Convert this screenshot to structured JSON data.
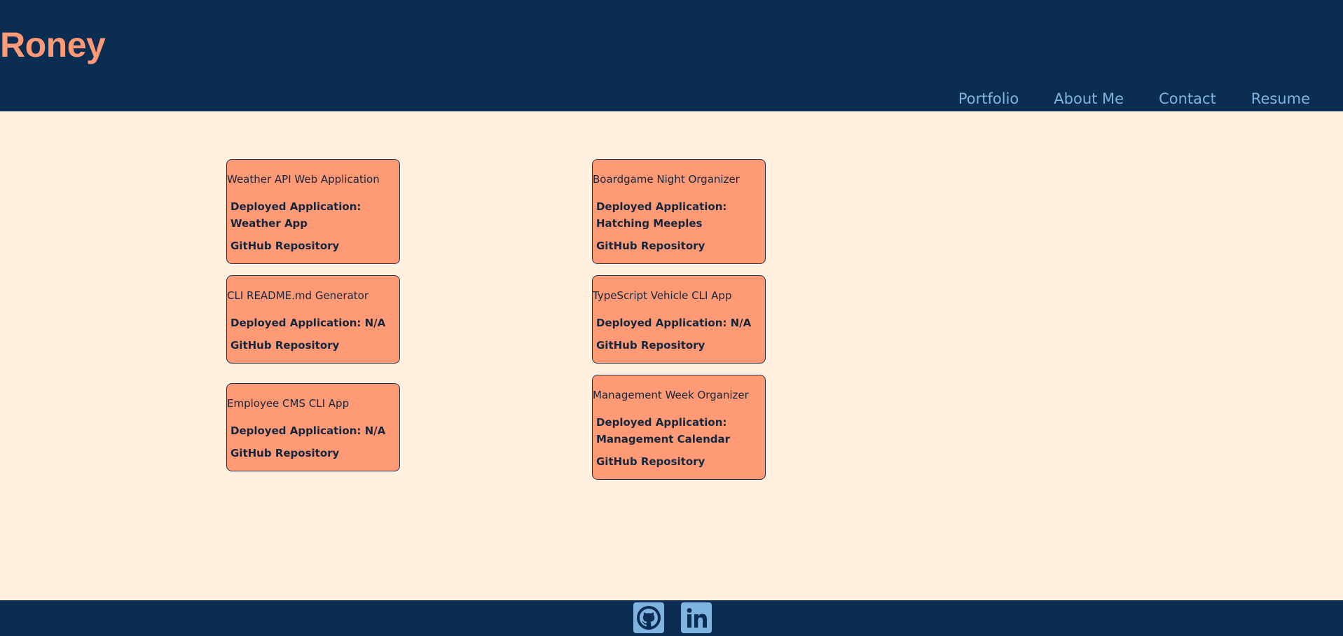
{
  "header": {
    "brand": "Roney",
    "nav": [
      "Portfolio",
      "About Me",
      "Contact",
      "Resume"
    ]
  },
  "projects": [
    {
      "title": "Weather API Web Application",
      "deployed": "Deployed Application: Weather App",
      "repo": "GitHub Repository"
    },
    {
      "title": "Boardgame Night Organizer",
      "deployed": "Deployed Application: Hatching Meeples",
      "repo": "GitHub Repository"
    },
    {
      "title": "CLI README.md Generator",
      "deployed": "Deployed Application: N/A",
      "repo": "GitHub Repository"
    },
    {
      "title": "TypeScript Vehicle CLI App",
      "deployed": "Deployed Application: N/A",
      "repo": "GitHub Repository"
    },
    {
      "title": "Employee CMS CLI App",
      "deployed": "Deployed Application: N/A",
      "repo": "GitHub Repository"
    },
    {
      "title": "Management Week Organizer",
      "deployed": "Deployed Application: Management Calendar",
      "repo": "GitHub Repository"
    }
  ],
  "footer": {
    "icons": [
      "github-icon",
      "linkedin-icon"
    ]
  },
  "colors": {
    "header_bg": "#0c2d52",
    "page_bg": "#fff0e0",
    "accent": "#ff9a76",
    "nav_text": "#7fb3e0"
  }
}
